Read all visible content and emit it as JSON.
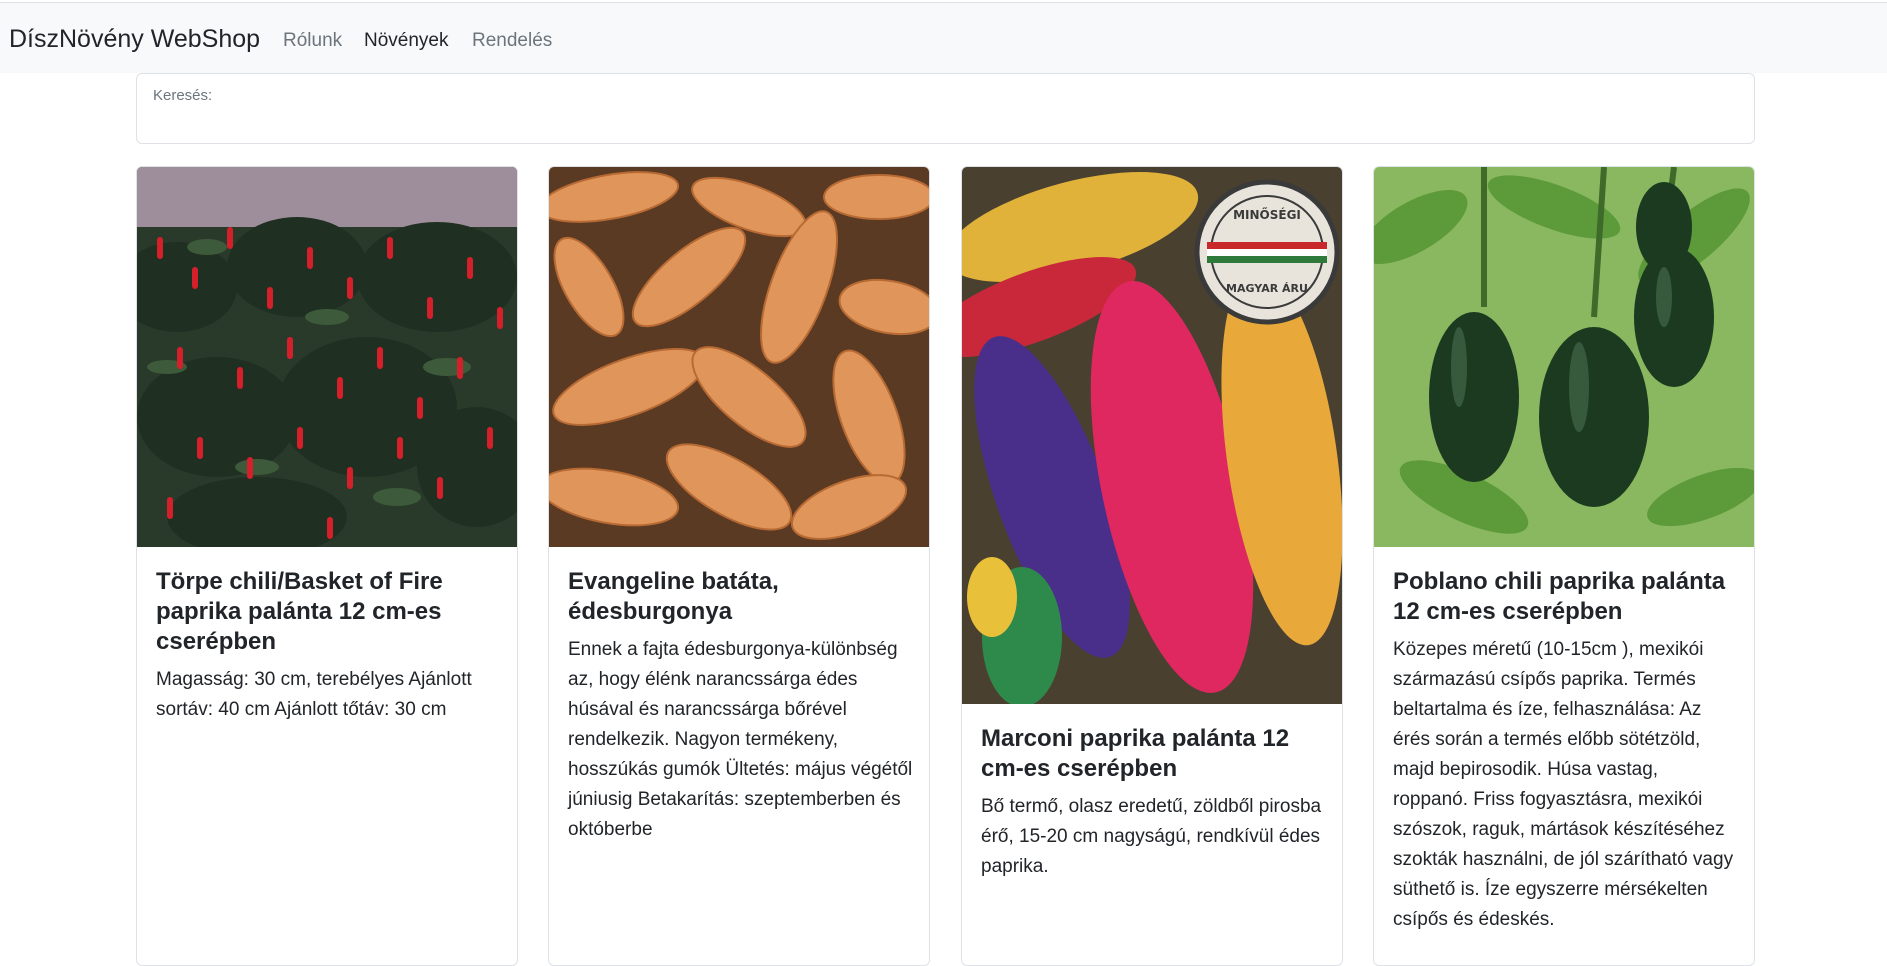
{
  "navbar": {
    "brand": "DíszNövény WebShop",
    "links": [
      "Rólunk",
      "Növények",
      "Rendelés"
    ],
    "active": "Növények"
  },
  "search": {
    "label": "Keresés:",
    "value": ""
  },
  "products": [
    {
      "title": "Törpe chili/Basket of Fire paprika palánta 12 cm-es cserépben",
      "description": "Magasság: 30 cm, terebélyes Ajánlott sortáv: 40 cm Ajánlott tőtáv: 30 cm",
      "image": "red-chili-plants-photo"
    },
    {
      "title": "Evangeline batáta, édesburgonya",
      "description": "Ennek a fajta édesburgonya-különbség az, hogy élénk narancssárga édes húsával és narancssárga bőrével rendelkezik. Nagyon termékeny, hosszúkás gumók Ültetés: május végétől júniusig Betakarítás: szeptemberben és októberbe",
      "image": "sweet-potatoes-photo"
    },
    {
      "title": "Marconi paprika palánta 12 cm-es cserépben",
      "description": "Bő termő, olasz eredetű, zöldből pirosba érő, 15-20 cm nagyságú, rendkívül édes paprika.",
      "image": "colorful-peppers-photo",
      "badge_lines": [
        "MINŐSÉGI",
        "MAGYAR ÁRU"
      ]
    },
    {
      "title": "Poblano chili paprika palánta 12 cm-es cserépben",
      "description": "Közepes méretű (10-15cm ), mexikói származású csípős paprika. Termés beltartalma és íze, felhasználása: Az érés során a termés előbb sötétzöld, majd bepirosodik. Húsa vastag, roppanó. Friss fogyasztásra, mexikói szószok, raguk, mártások készítéséhez szokták használni, de jól szárítható vagy süthető is. Íze egyszerre mérsékelten csípős és édeskés.",
      "image": "green-poblano-peppers-photo"
    }
  ]
}
